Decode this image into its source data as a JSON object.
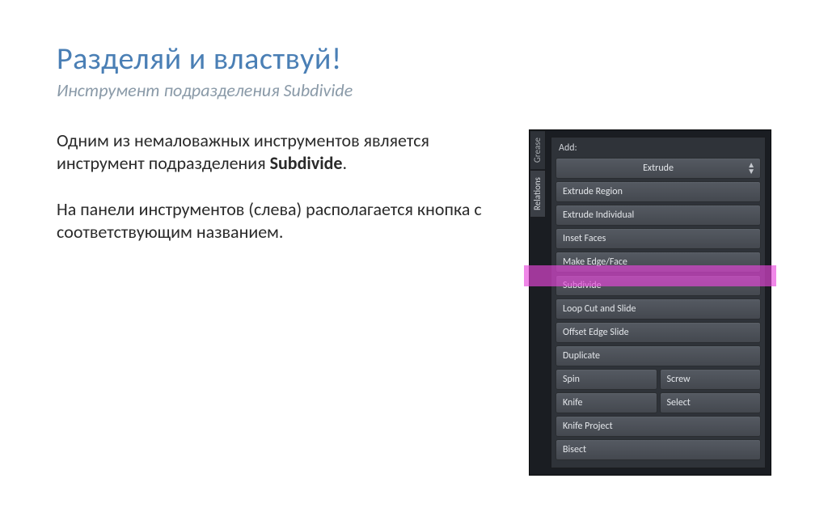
{
  "slide": {
    "title": "Разделяй и властвуй!",
    "subtitle": "Инструмент подразделения Subdivide",
    "para1_a": "Одним из немаловажных инструментов является инструмент подразделения ",
    "para1_b": "Subdivide",
    "para1_c": ".",
    "para2": "На панели инструментов (слева) располагается кнопка с соответствующим названием."
  },
  "panel": {
    "tabs": {
      "grease": "Grease",
      "relations": "Relations"
    },
    "header": "Add:",
    "items": {
      "extrude": "Extrude",
      "extrude_region": "Extrude Region",
      "extrude_individual": "Extrude Individual",
      "inset_faces": "Inset Faces",
      "make_edge_face": "Make Edge/Face",
      "subdivide": "Subdivide",
      "loop_cut": "Loop Cut and Slide",
      "offset_edge": "Offset Edge Slide",
      "duplicate": "Duplicate",
      "spin": "Spin",
      "screw": "Screw",
      "knife": "Knife",
      "select": "Select",
      "knife_project": "Knife Project",
      "bisect": "Bisect"
    }
  }
}
